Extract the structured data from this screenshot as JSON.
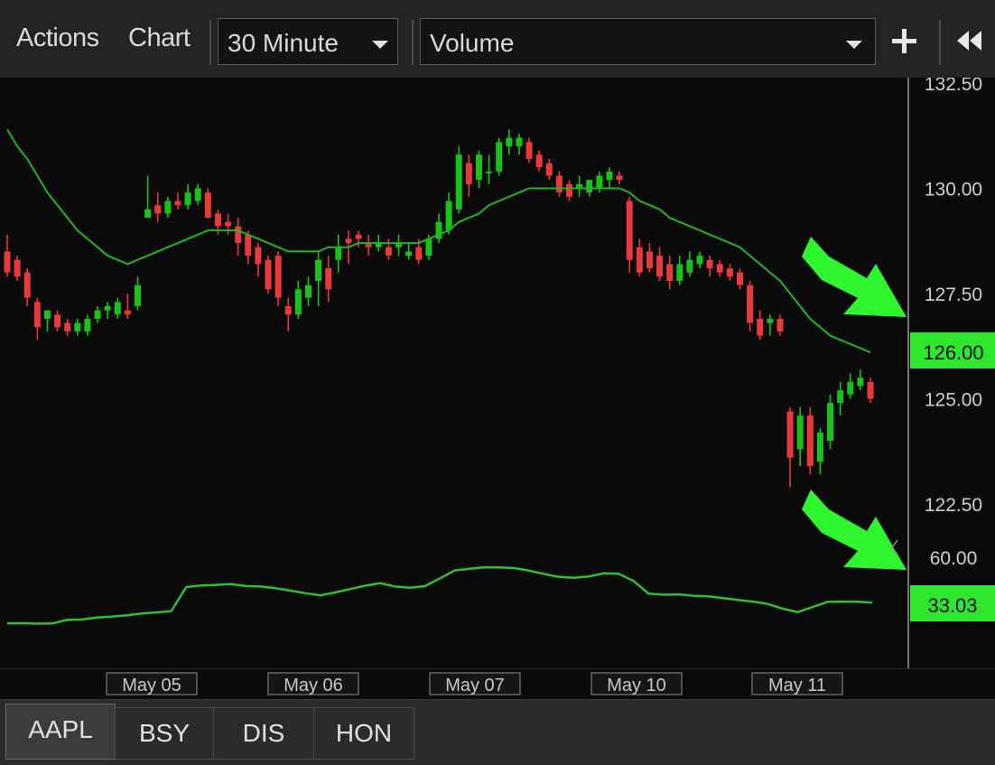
{
  "toolbar": {
    "actions_label": "Actions",
    "chart_label": "Chart",
    "interval": {
      "selected": "30 Minute"
    },
    "indicator": {
      "selected": "Volume"
    },
    "add_icon": "plus-icon",
    "collapse_icon": "double-chevron-left-icon"
  },
  "tabs": [
    {
      "label": "AAPL",
      "active": true
    },
    {
      "label": "BSY",
      "active": false
    },
    {
      "label": "DIS",
      "active": false
    },
    {
      "label": "HON",
      "active": false
    }
  ],
  "colors": {
    "up": "#19c219",
    "down": "#e83a3a",
    "ma": "#22b522",
    "volume_line": "#2fc02f",
    "price_highlight": "#2ee62e",
    "arrow": "#2ff52f"
  },
  "chart_data": {
    "type": "candlestick",
    "price_axis": {
      "ticks": [
        "132.50",
        "130.00",
        "127.50",
        "125.00",
        "122.50"
      ],
      "ylim": [
        121.7,
        132.9
      ],
      "current_value": "126.00"
    },
    "volume_axis": {
      "ticks": [
        "60.00"
      ],
      "ylim": [
        15,
        70
      ],
      "current_value": "33.03"
    },
    "date_labels": [
      "May 05",
      "May 06",
      "May 07",
      "May 10",
      "May 11"
    ],
    "candles": [
      [
        128.5,
        128.9,
        127.9,
        128.0
      ],
      [
        128.3,
        128.4,
        127.8,
        127.9
      ],
      [
        128.0,
        128.1,
        127.2,
        127.4
      ],
      [
        127.3,
        127.4,
        126.4,
        126.7
      ],
      [
        126.9,
        127.1,
        126.6,
        127.1
      ],
      [
        127.0,
        127.1,
        126.6,
        126.7
      ],
      [
        126.8,
        126.9,
        126.5,
        126.6
      ],
      [
        126.6,
        126.9,
        126.5,
        126.8
      ],
      [
        126.6,
        127.0,
        126.5,
        126.9
      ],
      [
        126.9,
        127.2,
        126.8,
        127.1
      ],
      [
        127.1,
        127.3,
        126.9,
        127.2
      ],
      [
        127.0,
        127.4,
        126.9,
        127.3
      ],
      [
        127.1,
        127.5,
        126.9,
        127.0
      ],
      [
        127.2,
        127.9,
        127.1,
        127.7
      ],
      [
        129.3,
        130.3,
        129.3,
        129.5
      ],
      [
        129.6,
        129.9,
        129.2,
        129.4
      ],
      [
        129.4,
        129.8,
        129.3,
        129.7
      ],
      [
        129.7,
        129.9,
        129.5,
        129.6
      ],
      [
        129.6,
        130.1,
        129.5,
        129.9
      ],
      [
        129.7,
        130.1,
        129.6,
        130.0
      ],
      [
        129.9,
        130.0,
        129.3,
        129.3
      ],
      [
        129.4,
        129.5,
        128.9,
        129.1
      ],
      [
        129.2,
        129.4,
        128.9,
        129.1
      ],
      [
        129.1,
        129.3,
        128.4,
        128.7
      ],
      [
        128.9,
        129.0,
        128.2,
        128.4
      ],
      [
        128.6,
        128.7,
        127.9,
        128.2
      ],
      [
        128.3,
        128.4,
        127.5,
        127.6
      ],
      [
        128.4,
        128.5,
        127.2,
        127.4
      ],
      [
        127.2,
        127.4,
        126.6,
        127.0
      ],
      [
        127.0,
        127.8,
        126.9,
        127.6
      ],
      [
        127.4,
        127.9,
        127.2,
        127.7
      ],
      [
        127.8,
        128.5,
        127.2,
        128.3
      ],
      [
        128.1,
        128.4,
        127.3,
        127.6
      ],
      [
        128.3,
        128.9,
        128.0,
        128.6
      ],
      [
        128.8,
        129.0,
        128.2,
        128.7
      ],
      [
        128.9,
        129.0,
        128.6,
        128.8
      ],
      [
        128.7,
        128.9,
        128.4,
        128.6
      ],
      [
        128.6,
        128.9,
        128.5,
        128.7
      ],
      [
        128.6,
        128.8,
        128.3,
        128.4
      ],
      [
        128.6,
        128.9,
        128.4,
        128.7
      ],
      [
        128.4,
        128.7,
        128.3,
        128.5
      ],
      [
        128.6,
        128.8,
        128.2,
        128.3
      ],
      [
        128.4,
        128.9,
        128.3,
        128.8
      ],
      [
        128.8,
        129.4,
        128.7,
        129.2
      ],
      [
        129.0,
        129.9,
        128.9,
        129.7
      ],
      [
        129.5,
        131.0,
        129.4,
        130.8
      ],
      [
        130.6,
        130.8,
        129.8,
        130.1
      ],
      [
        130.2,
        130.9,
        130.0,
        130.8
      ],
      [
        130.4,
        130.8,
        130.1,
        130.4
      ],
      [
        130.4,
        131.2,
        130.3,
        131.1
      ],
      [
        131.0,
        131.4,
        130.8,
        131.2
      ],
      [
        131.0,
        131.3,
        130.8,
        131.2
      ],
      [
        131.1,
        131.2,
        130.6,
        130.7
      ],
      [
        130.8,
        130.9,
        130.4,
        130.5
      ],
      [
        130.6,
        130.7,
        130.2,
        130.3
      ],
      [
        130.3,
        130.4,
        129.8,
        129.9
      ],
      [
        130.1,
        130.2,
        129.7,
        129.8
      ],
      [
        130.0,
        130.3,
        129.8,
        130.1
      ],
      [
        129.9,
        130.2,
        129.8,
        130.2
      ],
      [
        130.0,
        130.4,
        129.9,
        130.3
      ],
      [
        130.2,
        130.5,
        130.0,
        130.4
      ],
      [
        130.3,
        130.4,
        130.1,
        130.2
      ],
      [
        129.7,
        129.8,
        128.0,
        128.3
      ],
      [
        128.6,
        128.8,
        127.9,
        128.0
      ],
      [
        128.5,
        128.7,
        128.0,
        128.1
      ],
      [
        128.4,
        128.6,
        127.8,
        127.9
      ],
      [
        128.2,
        128.4,
        127.6,
        127.8
      ],
      [
        127.8,
        128.4,
        127.7,
        128.2
      ],
      [
        128.0,
        128.5,
        127.9,
        128.3
      ],
      [
        128.2,
        128.5,
        128.1,
        128.4
      ],
      [
        128.3,
        128.4,
        127.9,
        128.1
      ],
      [
        128.2,
        128.3,
        127.9,
        128.0
      ],
      [
        128.1,
        128.2,
        127.8,
        127.9
      ],
      [
        128.0,
        128.1,
        127.6,
        127.7
      ],
      [
        127.7,
        127.8,
        126.6,
        126.8
      ],
      [
        126.9,
        127.1,
        126.4,
        126.5
      ],
      [
        126.8,
        127.0,
        126.5,
        126.9
      ],
      [
        126.9,
        127.0,
        126.5,
        126.6
      ],
      [
        124.7,
        124.8,
        122.9,
        123.6
      ],
      [
        123.8,
        124.8,
        123.4,
        124.6
      ],
      [
        124.6,
        124.8,
        123.2,
        123.4
      ],
      [
        123.5,
        124.3,
        123.2,
        124.2
      ],
      [
        124.0,
        125.1,
        123.8,
        124.9
      ],
      [
        124.9,
        125.4,
        124.6,
        125.2
      ],
      [
        125.1,
        125.6,
        125.0,
        125.4
      ],
      [
        125.3,
        125.7,
        125.2,
        125.5
      ],
      [
        125.4,
        125.5,
        124.9,
        125.0
      ]
    ],
    "moving_average": [
      131.4,
      131.0,
      130.7,
      130.3,
      129.9,
      129.6,
      129.3,
      129.0,
      128.8,
      128.6,
      128.4,
      128.3,
      128.2,
      128.3,
      128.4,
      128.5,
      128.6,
      128.7,
      128.8,
      128.9,
      129.0,
      129.0,
      129.0,
      129.0,
      128.9,
      128.8,
      128.7,
      128.6,
      128.5,
      128.5,
      128.5,
      128.5,
      128.6,
      128.6,
      128.6,
      128.7,
      128.7,
      128.7,
      128.7,
      128.7,
      128.7,
      128.7,
      128.8,
      128.9,
      129.0,
      129.2,
      129.3,
      129.4,
      129.6,
      129.7,
      129.8,
      129.9,
      130.0,
      130.0,
      130.0,
      130.0,
      130.0,
      130.0,
      130.0,
      130.0,
      130.0,
      130.0,
      129.9,
      129.7,
      129.6,
      129.5,
      129.3,
      129.2,
      129.1,
      129.0,
      128.9,
      128.8,
      128.7,
      128.6,
      128.4,
      128.2,
      128.0,
      127.8,
      127.5,
      127.2,
      126.9,
      126.7,
      126.5,
      126.4,
      126.3,
      126.2,
      126.1
    ],
    "volume": [
      20.5,
      20.6,
      20.3,
      20.4,
      22.5,
      22.8,
      24.0,
      24.5,
      25.2,
      26.4,
      27.0,
      27.8,
      42.2,
      43.1,
      43.5,
      44.0,
      42.8,
      42.5,
      41.5,
      40.0,
      38.5,
      37.2,
      39.0,
      41.0,
      43.0,
      44.5,
      42.5,
      41.8,
      42.7,
      47.3,
      52.1,
      53.1,
      54.0,
      53.9,
      53.5,
      52.0,
      50.0,
      48.3,
      47.7,
      48.5,
      50.4,
      50.1,
      45.8,
      38.3,
      37.6,
      37.8,
      37.0,
      36.6,
      35.6,
      34.5,
      33.5,
      32.1,
      29.2,
      27.2,
      30.2,
      33.3,
      33.5,
      33.4,
      32.9
    ]
  }
}
